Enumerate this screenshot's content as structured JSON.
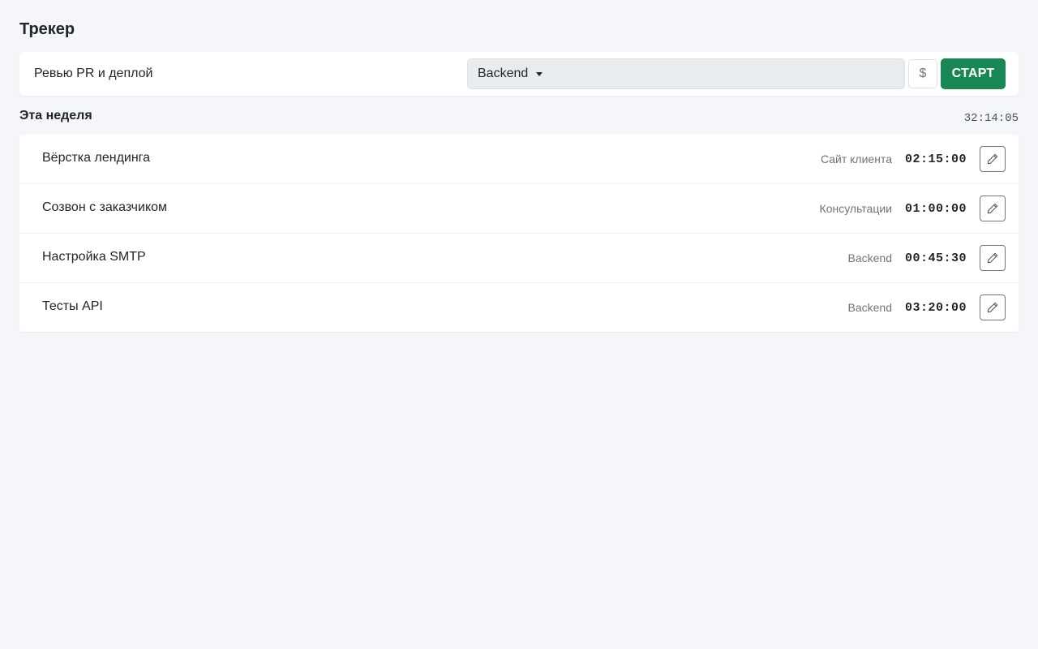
{
  "page": {
    "title": "Трекер"
  },
  "timer": {
    "task_value": "Ревью PR и деплой",
    "project_selected": "Backend",
    "billable_label": "$",
    "start_label": "СТАРТ"
  },
  "week": {
    "title": "Эта неделя",
    "total": "32:14:05"
  },
  "entries": [
    {
      "description": "Вёрстка лендинга",
      "project": "Сайт клиента",
      "duration": "02:15:00",
      "edit_icon": "pencil-icon"
    },
    {
      "description": "Созвон с заказчиком",
      "project": "Консультации",
      "duration": "01:00:00",
      "edit_icon": "pencil-icon"
    },
    {
      "description": "Настройка SMTP",
      "project": "Backend",
      "duration": "00:45:30",
      "edit_icon": "pencil-icon"
    },
    {
      "description": "Тесты API",
      "project": "Backend",
      "duration": "03:20:00",
      "edit_icon": "pencil-icon"
    }
  ],
  "colors": {
    "background": "#f4f6fa",
    "start_button": "#198754",
    "select_bg": "#e9ecef"
  }
}
